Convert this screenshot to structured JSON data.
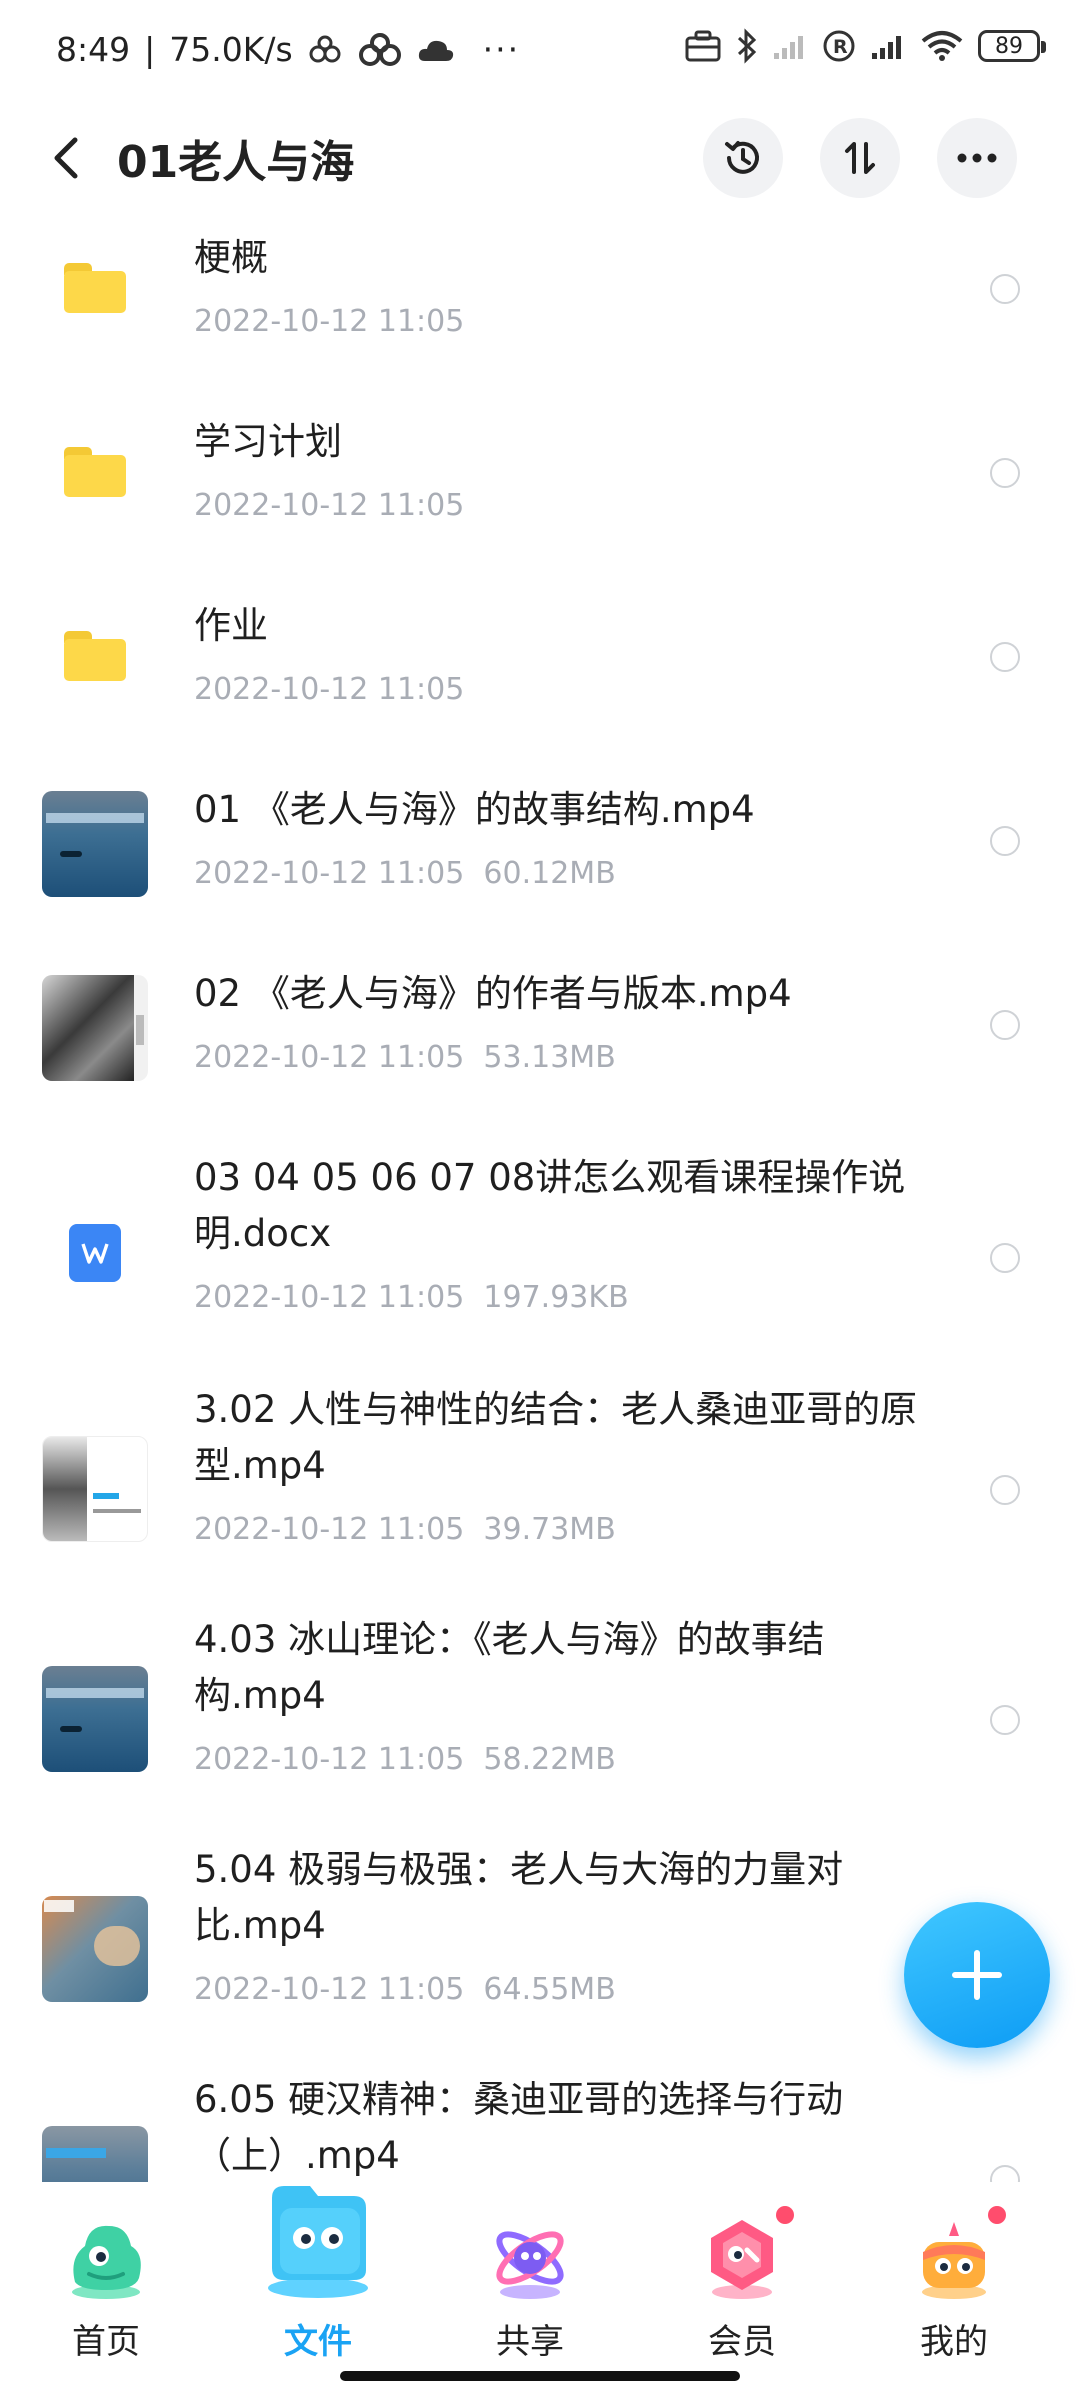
{
  "status_bar": {
    "time": "8:49",
    "separator": "|",
    "speed": "75.0K/s",
    "more": "···",
    "battery": "89"
  },
  "header": {
    "title": "01老人与海",
    "back_icon": "chevron-left-icon",
    "actions": [
      "history-icon",
      "sort-icon",
      "more-icon"
    ]
  },
  "files": [
    {
      "name": "梗概",
      "date": "2022-10-12  11:05",
      "size": "",
      "type": "folder"
    },
    {
      "name": "学习计划",
      "date": "2022-10-12  11:05",
      "size": "",
      "type": "folder"
    },
    {
      "name": "作业",
      "date": "2022-10-12  11:05",
      "size": "",
      "type": "folder"
    },
    {
      "name": "01 《老人与海》的故事结构.mp4",
      "date": "2022-10-12  11:05",
      "size": "60.12MB",
      "type": "video"
    },
    {
      "name": "02 《老人与海》的作者与版本.mp4",
      "date": "2022-10-12  11:05",
      "size": "53.13MB",
      "type": "video"
    },
    {
      "name": "03 04  05 06 07 08讲怎么观看课程操作说明.docx",
      "date": "2022-10-12  11:05",
      "size": "197.93KB",
      "type": "docx"
    },
    {
      "name": "3.02 人性与神性的结合：老人桑迪亚哥的原型.mp4",
      "date": "2022-10-12  11:05",
      "size": "39.73MB",
      "type": "video"
    },
    {
      "name": "4.03 冰山理论：《老人与海》的故事结构.mp4",
      "date": "2022-10-12  11:05",
      "size": "58.22MB",
      "type": "video"
    },
    {
      "name": "5.04 极弱与极强：老人与大海的力量对比.mp4",
      "date": "2022-10-12  11:05",
      "size": "64.55MB",
      "type": "video"
    },
    {
      "name": "6.05 硬汉精神：桑迪亚哥的选择与行动（上）.mp4",
      "date": "",
      "size": "",
      "type": "video"
    }
  ],
  "fab": {
    "icon": "plus-icon"
  },
  "nav": [
    {
      "label": "首页",
      "icon": "home-icon"
    },
    {
      "label": "文件",
      "icon": "files-icon"
    },
    {
      "label": "共享",
      "icon": "share-icon"
    },
    {
      "label": "会员",
      "icon": "vip-icon"
    },
    {
      "label": "我的",
      "icon": "profile-icon"
    }
  ],
  "colors": {
    "accent": "#1aa3f4",
    "folder": "#fdd849",
    "meta": "#a9adb5"
  }
}
